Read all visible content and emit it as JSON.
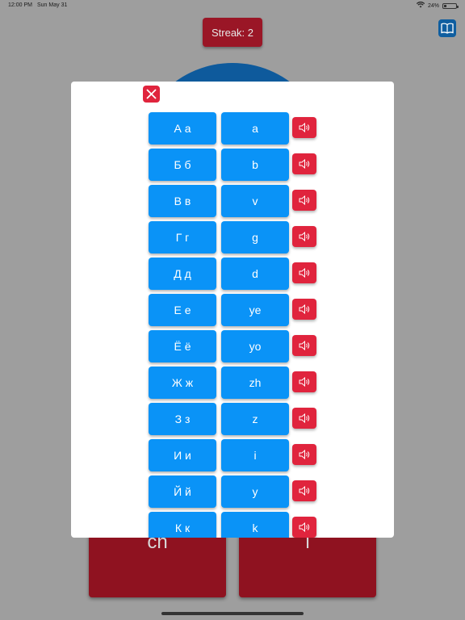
{
  "status_bar": {
    "time": "12:00 PM",
    "date": "Sun May 31",
    "battery_text": "24%",
    "battery_level": 0.24
  },
  "header": {
    "streak_label": "Streak: 2",
    "book_icon": "book-icon"
  },
  "answers": {
    "left_label": "ch",
    "right_label": "i"
  },
  "modal": {
    "close_icon": "close-icon",
    "sound_icon": "speaker-icon",
    "rows": [
      {
        "letter": "А а",
        "translit": "a"
      },
      {
        "letter": "Б б",
        "translit": "b"
      },
      {
        "letter": "В в",
        "translit": "v"
      },
      {
        "letter": "Г г",
        "translit": "g"
      },
      {
        "letter": "Д д",
        "translit": "d"
      },
      {
        "letter": "Е е",
        "translit": "ye"
      },
      {
        "letter": "Ё ё",
        "translit": "yo"
      },
      {
        "letter": "Ж ж",
        "translit": "zh"
      },
      {
        "letter": "З з",
        "translit": "z"
      },
      {
        "letter": "И и",
        "translit": "i"
      },
      {
        "letter": "Й й",
        "translit": "y"
      },
      {
        "letter": "К к",
        "translit": "k"
      }
    ]
  },
  "colors": {
    "letter_button": "#0a93f7",
    "sound_button": "#e0243d",
    "streak_button": "#9a1626",
    "backdrop": "#9e9e9e"
  }
}
